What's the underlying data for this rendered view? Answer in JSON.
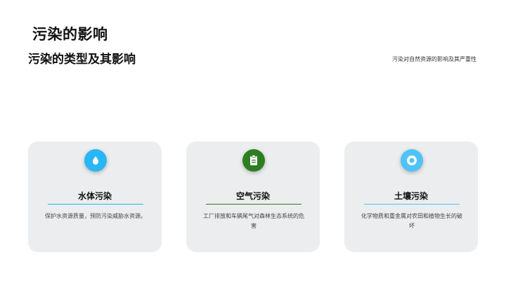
{
  "slide": {
    "title": "污染的影响",
    "subtitle": "污染的类型及其影响",
    "note": "污染对自然资源的影响及其严重性"
  },
  "cards": [
    {
      "title": "水体污染",
      "description": "保护水资源质量，预防污染威胁水资源。",
      "icon": "water-drop-icon",
      "icon_color": "#29b6f6",
      "rule_color": "#29b6f6"
    },
    {
      "title": "空气污染",
      "description": "工厂排放和车辆尾气对森林生态系统的危害",
      "icon": "clipboard-icon",
      "icon_color": "#2e7d22",
      "rule_color": "#2e7d22"
    },
    {
      "title": "土壤污染",
      "description": "化学物质和重金属对农田和植物生长的破坏",
      "icon": "target-icon",
      "icon_color": "#4fc3f7",
      "rule_color": "#4fc3f7"
    }
  ]
}
